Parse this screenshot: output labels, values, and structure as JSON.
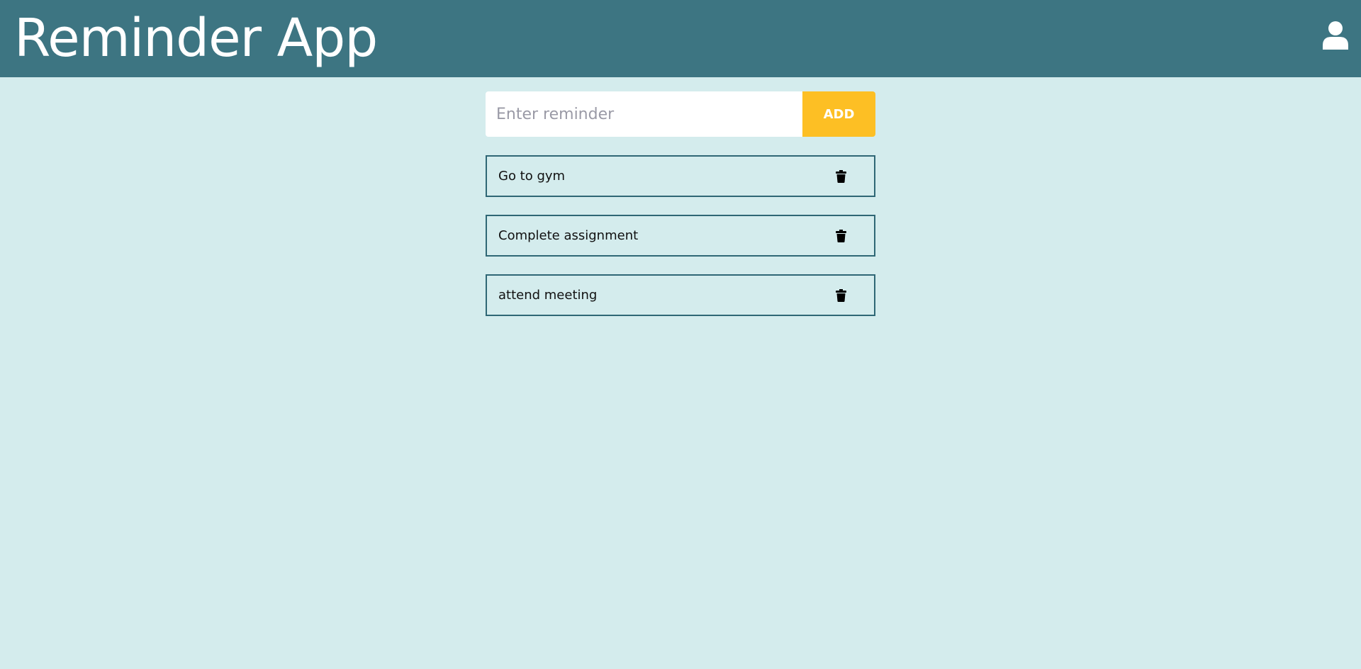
{
  "header": {
    "title": "Reminder App",
    "background": "#3d7582",
    "user_icon": "user-icon"
  },
  "composer": {
    "placeholder": "Enter reminder",
    "value": "",
    "add_label": "ADD",
    "add_color": "#fdbf24"
  },
  "reminders": [
    {
      "text": "Go to gym",
      "icon": "trash-icon"
    },
    {
      "text": "Complete assignment",
      "icon": "trash-icon"
    },
    {
      "text": "attend meeting",
      "icon": "trash-icon"
    }
  ],
  "colors": {
    "page_background": "#d4eced",
    "item_border": "#2f6775"
  }
}
